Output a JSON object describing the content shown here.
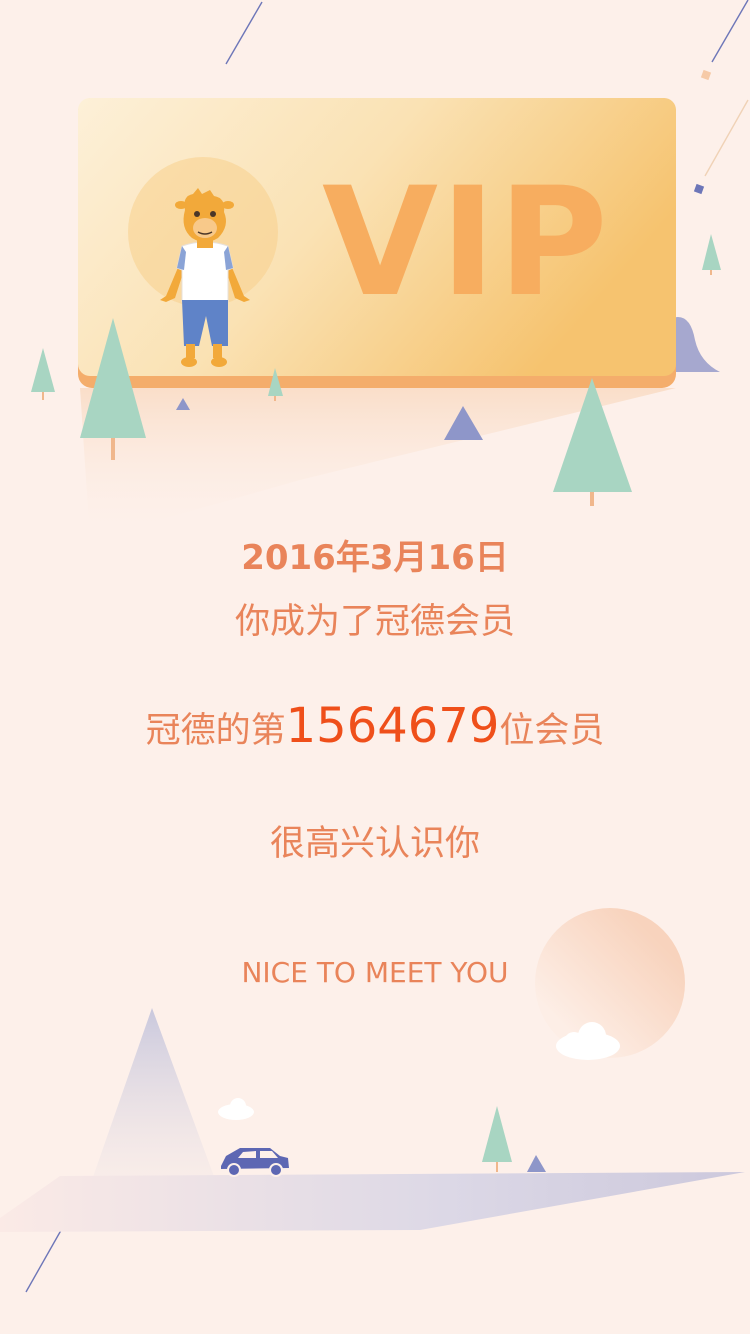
{
  "card": {
    "badge_text": "VIP"
  },
  "message": {
    "date_line": "2016年3月16日",
    "became_line": "你成为了冠德会员",
    "rank_prefix": "冠德的第",
    "rank_number": "1564679",
    "rank_suffix": "位会员",
    "greeting": "很高兴认识你",
    "greeting_en": "NICE TO MEET YOU"
  },
  "colors": {
    "background": "#fdf0ea",
    "card_orange": "#f7ad5f",
    "text_orange": "#e9845a",
    "accent_red": "#ef4f1a",
    "tree_green": "#a8d5c2",
    "mountain_blue": "#8e96c9"
  },
  "icons": [
    "camel-mascot-icon",
    "pine-tree-icon",
    "car-icon",
    "cloud-icon",
    "sun-circle-icon",
    "mountain-icon"
  ]
}
